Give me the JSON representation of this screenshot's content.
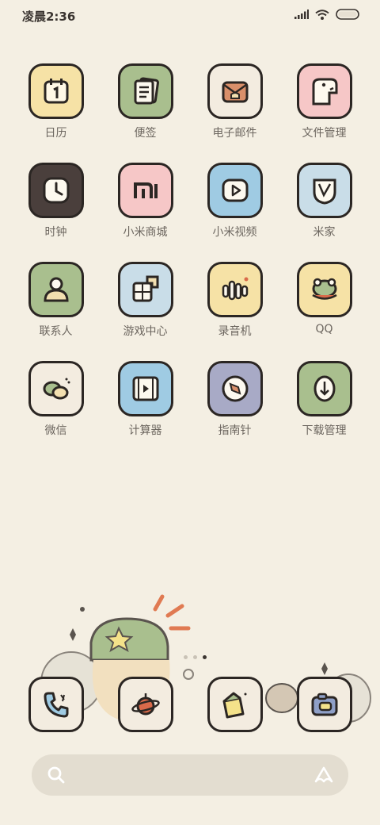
{
  "status_bar": {
    "time": "凌晨2:36"
  },
  "apps": [
    {
      "label": "日历",
      "icon": "calendar-icon",
      "bg": "#f6e2a6"
    },
    {
      "label": "便签",
      "icon": "notes-icon",
      "bg": "#a9bf8e"
    },
    {
      "label": "电子邮件",
      "icon": "mail-icon",
      "bg": "#f3ece0"
    },
    {
      "label": "文件管理",
      "icon": "dinosaur-icon",
      "bg": "#f6c7c7"
    },
    {
      "label": "时钟",
      "icon": "clock-icon",
      "bg": "#4a3f3c"
    },
    {
      "label": "小米商城",
      "icon": "mi-icon",
      "bg": "#f6c7c7"
    },
    {
      "label": "小米视频",
      "icon": "video-play-icon",
      "bg": "#9fcbe3"
    },
    {
      "label": "米家",
      "icon": "mijia-icon",
      "bg": "#c9dde8"
    },
    {
      "label": "联系人",
      "icon": "person-icon",
      "bg": "#a9bf8e"
    },
    {
      "label": "游戏中心",
      "icon": "puzzle-icon",
      "bg": "#c9dde8"
    },
    {
      "label": "录音机",
      "icon": "recorder-icon",
      "bg": "#f6e2a6"
    },
    {
      "label": "QQ",
      "icon": "frog-icon",
      "bg": "#f6e2a6"
    },
    {
      "label": "微信",
      "icon": "wechat-icon",
      "bg": "#f3ece0"
    },
    {
      "label": "计算器",
      "icon": "film-icon",
      "bg": "#9fcbe3"
    },
    {
      "label": "指南针",
      "icon": "compass-icon",
      "bg": "#a8aac6"
    },
    {
      "label": "下载管理",
      "icon": "download-icon",
      "bg": "#a9bf8e"
    }
  ],
  "dock": [
    {
      "icon": "phone-icon",
      "bg": "#f3ece0"
    },
    {
      "icon": "planet-icon",
      "bg": "#f3ece0"
    },
    {
      "icon": "messages-icon",
      "bg": "#f3ece0"
    },
    {
      "icon": "camera-icon",
      "bg": "#f3ece0"
    }
  ],
  "page_indicator": {
    "count": 3,
    "active": 3
  }
}
